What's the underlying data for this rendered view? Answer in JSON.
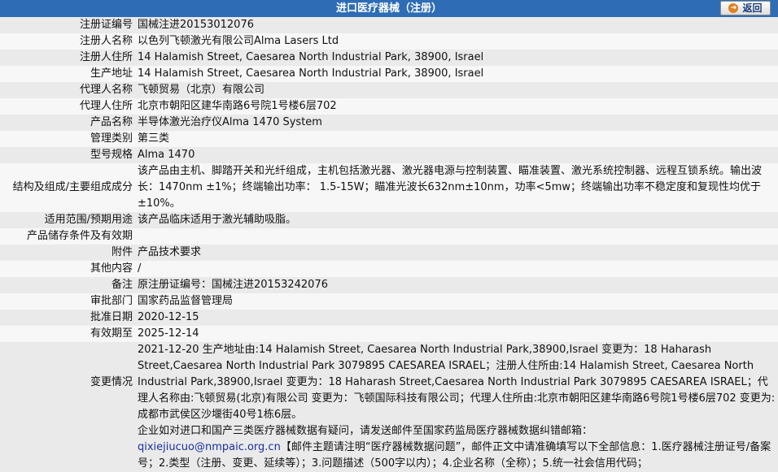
{
  "header": {
    "title": "进口医疗器械（注册）",
    "back_label": "返回"
  },
  "rows": [
    {
      "label": "注册证编号",
      "value": "国械注进20153012076"
    },
    {
      "label": "注册人名称",
      "value": "以色列飞顿激光有限公司Alma Lasers Ltd"
    },
    {
      "label": "注册人住所",
      "value": "14 Halamish Street, Caesarea North Industrial Park, 38900, Israel"
    },
    {
      "label": "生产地址",
      "value": "14 Halamish Street, Caesarea North Industrial Park, 38900, Israel"
    },
    {
      "label": "代理人名称",
      "value": "飞顿贸易（北京）有限公司"
    },
    {
      "label": "代理人住所",
      "value": "北京市朝阳区建华南路6号院1号楼6层702"
    },
    {
      "label": "产品名称",
      "value": "半导体激光治疗仪Alma 1470 System"
    },
    {
      "label": "管理类别",
      "value": "第三类"
    },
    {
      "label": "型号规格",
      "value": "Alma 1470"
    },
    {
      "label": "结构及组成/主要组成成分",
      "value": "该产品由主机、脚踏开关和光纤组成，主机包括激光器、激光器电源与控制装置、瞄准装置、激光系统控制器、远程互锁系统。输出波长：1470nm ±1%；终端输出功率： 1.5-15W；瞄准光波长632nm±10nm，功率<5mw；终端输出功率不稳定度和复现性均优于±10%。"
    },
    {
      "label": "适用范围/预期用途",
      "value": "该产品临床适用于激光辅助吸脂。"
    },
    {
      "label": "产品储存条件及有效期",
      "value": ""
    },
    {
      "label": "附件",
      "value": "产品技术要求"
    },
    {
      "label": "其他内容",
      "value": "/"
    },
    {
      "label": "备注",
      "value": "原注册证编号：国械注进20153242076"
    },
    {
      "label": "审批部门",
      "value": "国家药品监督管理局"
    },
    {
      "label": "批准日期",
      "value": "2020-12-15"
    },
    {
      "label": "有效期至",
      "value": "2025-12-14"
    },
    {
      "label": "变更情况",
      "value": "2021-12-20 生产地址由:14 Halamish Street, Caesarea North Industrial Park,38900,Israel 变更为：18 Haharash Street,Caesarea North Industrial Park 3079895 CAESAREA ISRAEL；注册人住所由:14 Halamish Street, Caesarea North Industrial Park,38900,Israel 变更为：18 Haharash Street,Caesarea North Industrial Park 3079895 CAESAREA ISRAEL；代理人名称由:飞顿贸易(北京)有限公司 变更为：飞顿国际科技有限公司；代理人住所由:北京市朝阳区建华南路6号院1号楼6层702 变更为: 成都市武侯区沙堰街40号1栋6层。"
    }
  ],
  "notice": {
    "text_before": "企业如对进口和国产三类医疗器械数据有疑问，请发送邮件至国家药监局医疗器械数据纠错邮箱：",
    "email": "qixiejiucuo@nmpaic.org.cn",
    "text_after": "【邮件主题请注明“医疗器械数据问题”，邮件正文中请准确填写以下全部信息：1.医疗器械注册证号/备案号；2.类型（注册、变更、延续等）；3.问题描述（500字以内）；4.企业名称（全称）；5.统一社会信用代码；"
  }
}
